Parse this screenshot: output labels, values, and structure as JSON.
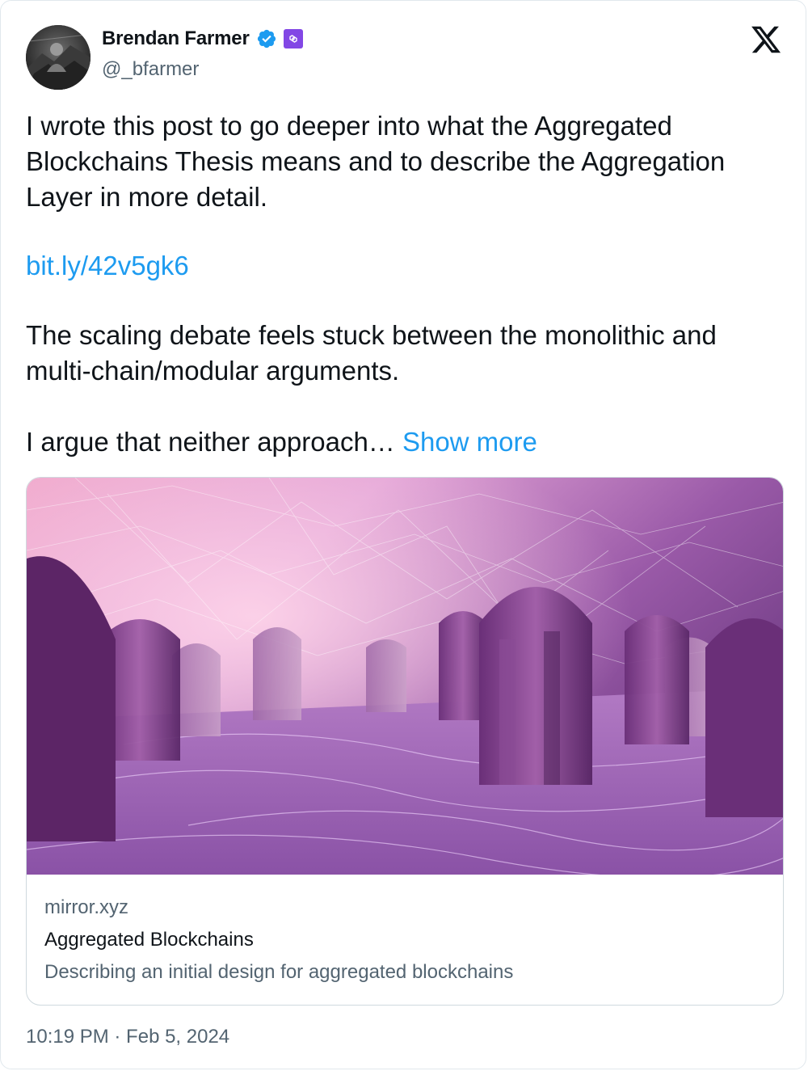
{
  "author": {
    "display_name": "Brendan Farmer",
    "handle": "@_bfarmer",
    "verified_icon": "verified-badge-icon",
    "affiliate_icon": "polygon-affiliate-badge-icon"
  },
  "brand": {
    "logo_icon": "x-logo-icon"
  },
  "tweet": {
    "text_para1": "I wrote this post to go deeper into what the Aggregated Blockchains Thesis means and to describe the Aggregation Layer in more detail.",
    "link": "bit.ly/42v5gk6",
    "text_para2": "The scaling debate feels stuck between the monolithic and multi-chain/modular arguments.",
    "text_para3": "I argue that neither approach…",
    "show_more": "Show more",
    "timestamp": "10:19 PM · Feb 5, 2024"
  },
  "link_card": {
    "domain": "mirror.xyz",
    "title": "Aggregated Blockchains",
    "description": "Describing an initial design for aggregated blockchains"
  },
  "colors": {
    "link_blue": "#1d9bf0",
    "verified_blue": "#1d9bf0",
    "affiliate_purple": "#8247e5",
    "secondary_text": "#536471"
  }
}
